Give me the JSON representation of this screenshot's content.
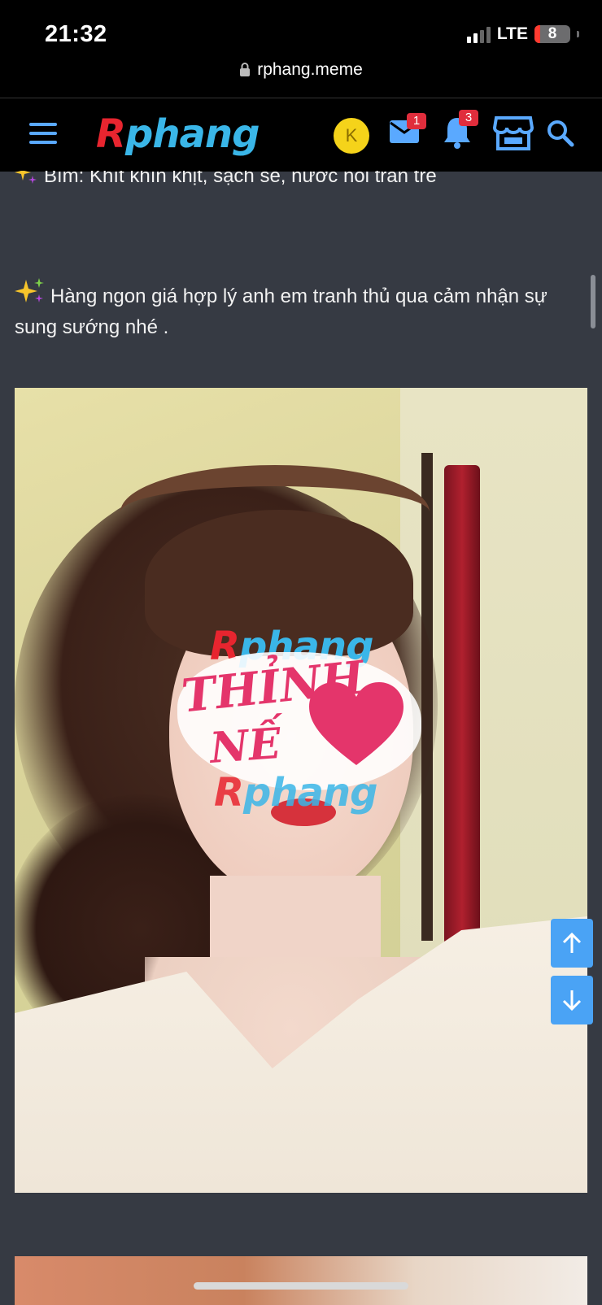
{
  "status_bar": {
    "time": "21:32",
    "network": "LTE",
    "battery": "8"
  },
  "browser": {
    "url": "rphang.meme"
  },
  "nav": {
    "logo_r": "R",
    "logo_rest": "phang",
    "avatar_letter": "K",
    "messages_badge": "1",
    "notifications_badge": "3"
  },
  "post": {
    "line_top": "Bím: Khít khìn khịt, sạch sẽ, nước nôi tràn trề",
    "line_main": "Hàng ngon giá hợp lý anh em tranh thủ qua cảm nhận sự sung sướng nhé ."
  },
  "watermark": {
    "logo_r": "R",
    "logo_rest": "phang",
    "thinh_line1": "THỈNH",
    "thinh_line2": "NẾ"
  },
  "colors": {
    "accent": "#4aa3f5",
    "badge": "#e02d3c",
    "logo_red": "#e8252f",
    "logo_blue": "#3ab6e8",
    "background": "#363a43"
  }
}
